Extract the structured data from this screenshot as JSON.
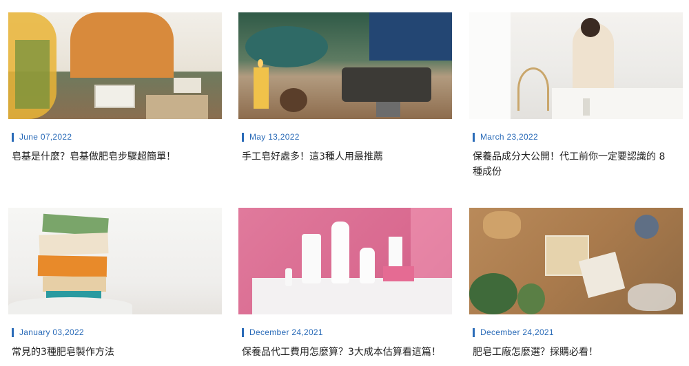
{
  "posts": [
    {
      "date": "June 07,2022",
      "title": "皂基是什麼？皂基做肥皂步驟超簡單！"
    },
    {
      "date": "May 13,2022",
      "title": "手工皂好處多！這3種人用最推薦"
    },
    {
      "date": "March 23,2022",
      "title": "保養品成分大公開！代工前你一定要認識的 8 種成份"
    },
    {
      "date": "January 03,2022",
      "title": "常見的3種肥皂製作方法"
    },
    {
      "date": "December 24,2021",
      "title": "保養品代工費用怎麼算？3大成本估算看這篇！"
    },
    {
      "date": "December 24,2021",
      "title": "肥皂工廠怎麼選？採購必看！"
    }
  ]
}
